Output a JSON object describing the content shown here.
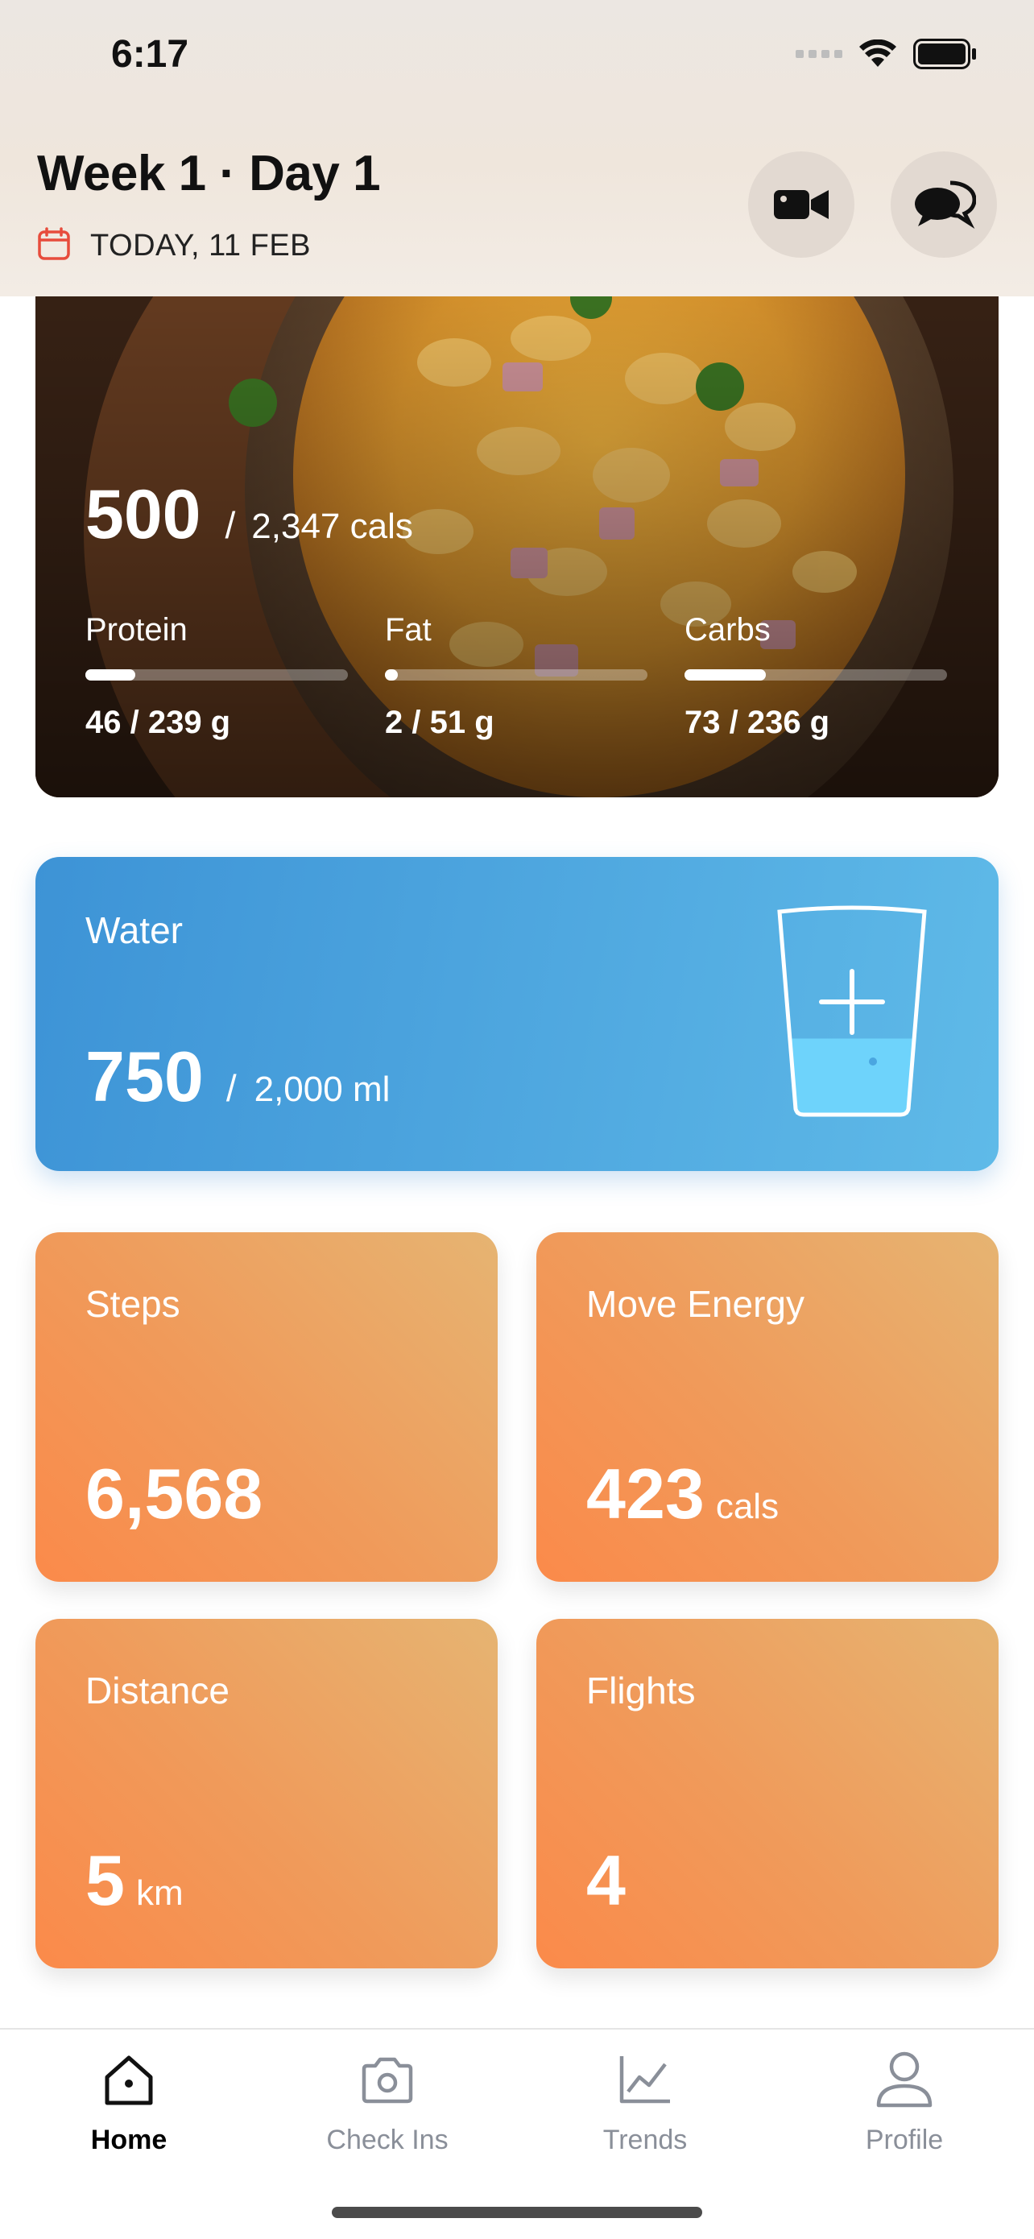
{
  "status": {
    "time": "6:17"
  },
  "header": {
    "title": "Week 1 · Day 1",
    "date": "TODAY, 11 FEB",
    "icons": {
      "calendar": "calendar-icon",
      "video": "video-camera-icon",
      "chat": "chat-bubbles-icon"
    },
    "accent": "#e74c3c"
  },
  "meal": {
    "calories": "500",
    "separator": "/",
    "calories_total": "2,347 cals",
    "macros": [
      {
        "label": "Protein",
        "value": "46 / 239 g",
        "progress": 0.19
      },
      {
        "label": "Fat",
        "value": "2 / 51 g",
        "progress": 0.04
      },
      {
        "label": "Carbs",
        "value": "73 / 236 g",
        "progress": 0.31
      }
    ]
  },
  "water": {
    "label": "Water",
    "value": "750",
    "separator": "/",
    "total": "2,000 ml",
    "fill_fraction": 0.375,
    "color": "#4aa6e0"
  },
  "stats": {
    "steps": {
      "label": "Steps",
      "value": "6,568",
      "unit": ""
    },
    "move": {
      "label": "Move Energy",
      "value": "423",
      "unit": "cals"
    },
    "distance": {
      "label": "Distance",
      "value": "5",
      "unit": "km"
    },
    "flights": {
      "label": "Flights",
      "value": "4",
      "unit": ""
    },
    "color": "#f7934f"
  },
  "tabs": [
    {
      "label": "Home",
      "icon": "home-icon",
      "active": true
    },
    {
      "label": "Check Ins",
      "icon": "camera-icon",
      "active": false
    },
    {
      "label": "Trends",
      "icon": "chart-icon",
      "active": false
    },
    {
      "label": "Profile",
      "icon": "person-icon",
      "active": false
    }
  ]
}
